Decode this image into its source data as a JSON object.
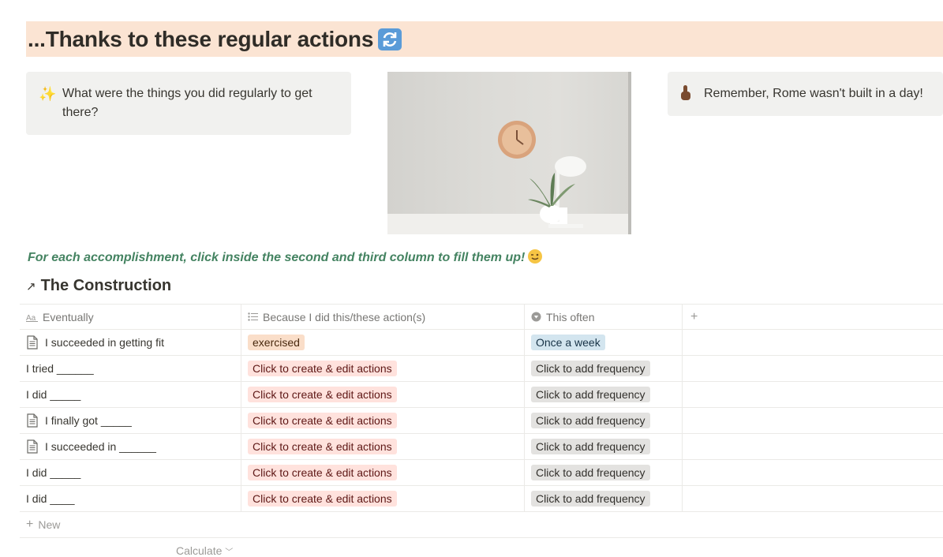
{
  "heading": {
    "title": "...Thanks to these regular actions",
    "icon": "refresh-icon"
  },
  "callout_left": {
    "icon": "sparkles-icon",
    "text": "What were the things you did regularly to get there?"
  },
  "callout_right": {
    "icon": "pointing-up-hand-icon",
    "text": "Remember, Rome wasn't built in a day!"
  },
  "image": {
    "subject": "wall-clock-plant-lamp-photo"
  },
  "hint": {
    "text": "For each accomplishment, click inside the second and third column to fill them up!",
    "icon": "wink-emoji-icon"
  },
  "database": {
    "title": "The Construction",
    "columns": [
      {
        "label": "Eventually",
        "icon": "text-property-icon"
      },
      {
        "label": "Because I did this/these action(s)",
        "icon": "list-property-icon"
      },
      {
        "label": "This often",
        "icon": "select-property-icon"
      }
    ],
    "add_column_label": "+",
    "rows": [
      {
        "name": "I succeeded in getting fit",
        "has_page_icon": true,
        "action": "exercised",
        "action_color": "orange",
        "frequency": "Once a week",
        "frequency_color": "blue"
      },
      {
        "name": "I tried ______",
        "has_page_icon": false,
        "action": "Click to create & edit actions",
        "action_color": "red",
        "frequency": "Click to add frequency",
        "frequency_color": "gray"
      },
      {
        "name": "I did _____",
        "has_page_icon": false,
        "action": "Click to create & edit actions",
        "action_color": "red",
        "frequency": "Click to add frequency",
        "frequency_color": "gray"
      },
      {
        "name": "I finally got _____",
        "has_page_icon": true,
        "action": "Click to create & edit actions",
        "action_color": "red",
        "frequency": "Click to add frequency",
        "frequency_color": "gray"
      },
      {
        "name": " I succeeded in ______",
        "has_page_icon": true,
        "action": "Click to create & edit actions",
        "action_color": "red",
        "frequency": "Click to add frequency",
        "frequency_color": "gray"
      },
      {
        "name": "I did _____",
        "has_page_icon": false,
        "action": "Click to create & edit actions",
        "action_color": "red",
        "frequency": "Click to add frequency",
        "frequency_color": "gray"
      },
      {
        "name": "I did ____",
        "has_page_icon": false,
        "action": "Click to create & edit actions",
        "action_color": "red",
        "frequency": "Click to add frequency",
        "frequency_color": "gray"
      }
    ],
    "new_label": "New",
    "calculate_label": "Calculate"
  }
}
